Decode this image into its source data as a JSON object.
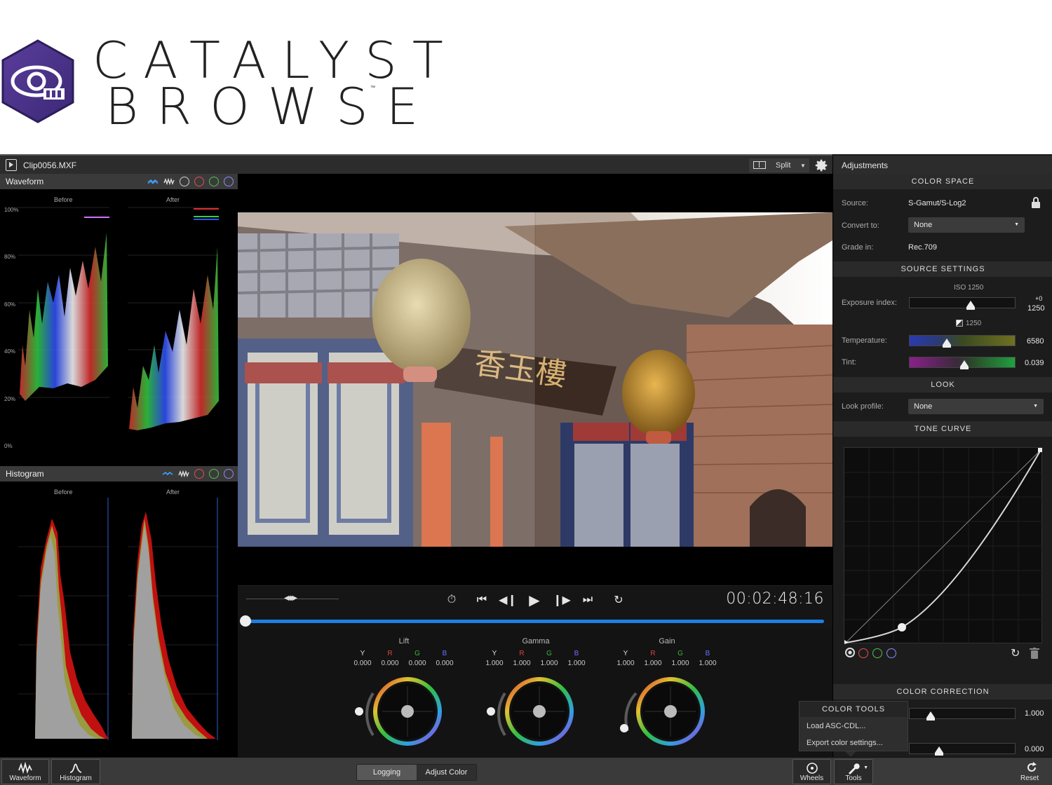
{
  "brand": {
    "line1": "CATALYST",
    "line2": "BROWSE",
    "tm": "™",
    "accent": "#4a3487"
  },
  "titlebar": {
    "clip_name": "Clip0056.MXF",
    "view_mode": "Split",
    "settings_icon": "gear-icon"
  },
  "waveform": {
    "title": "Waveform",
    "before_label": "Before",
    "after_label": "After",
    "scale": [
      "100%",
      "80%",
      "60%",
      "40%",
      "20%",
      "0%"
    ]
  },
  "histogram": {
    "title": "Histogram",
    "before_label": "Before",
    "after_label": "After"
  },
  "transport": {
    "timecode": "00:02:48:16",
    "position": 0.0
  },
  "wheels": [
    {
      "title": "Lift",
      "channels": [
        "Y",
        "R",
        "G",
        "B"
      ],
      "values": [
        "0.000",
        "0.000",
        "0.000",
        "0.000"
      ]
    },
    {
      "title": "Gamma",
      "channels": [
        "Y",
        "R",
        "G",
        "B"
      ],
      "values": [
        "1.000",
        "1.000",
        "1.000",
        "1.000"
      ]
    },
    {
      "title": "Gain",
      "channels": [
        "Y",
        "R",
        "G",
        "B"
      ],
      "values": [
        "1.000",
        "1.000",
        "1.000",
        "1.000"
      ]
    }
  ],
  "adjustments": {
    "title": "Adjustments",
    "color_space": {
      "header": "COLOR SPACE",
      "source_label": "Source:",
      "source_value": "S-Gamut/S-Log2",
      "convert_label": "Convert to:",
      "convert_value": "None",
      "grade_label": "Grade in:",
      "grade_value": "Rec.709"
    },
    "source_settings": {
      "header": "SOURCE SETTINGS",
      "iso": "ISO 1250",
      "exposure_label": "Exposure index:",
      "exposure_offset": "+0",
      "exposure_value": "1250",
      "exposure_sub": "1250",
      "temperature_label": "Temperature:",
      "temperature_value": "6580",
      "tint_label": "Tint:",
      "tint_value": "0.039"
    },
    "look": {
      "header": "LOOK",
      "profile_label": "Look profile:",
      "profile_value": "None"
    },
    "tone_curve": {
      "header": "TONE CURVE"
    },
    "color_correction": {
      "header": "COLOR CORRECTION",
      "value1": "1.000",
      "value2": "0.000"
    }
  },
  "color_tools": {
    "header": "COLOR TOOLS",
    "items": [
      "Load ASC-CDL...",
      "Export color settings..."
    ]
  },
  "bottombar": {
    "waveform": "Waveform",
    "histogram": "Histogram",
    "mode_logging": "Logging",
    "mode_adjust": "Adjust Color",
    "wheels": "Wheels",
    "tools": "Tools",
    "reset": "Reset"
  },
  "colors": {
    "scrub": "#1f7fe0",
    "panel": "#1c1c1c",
    "header": "#2a2a2a"
  }
}
